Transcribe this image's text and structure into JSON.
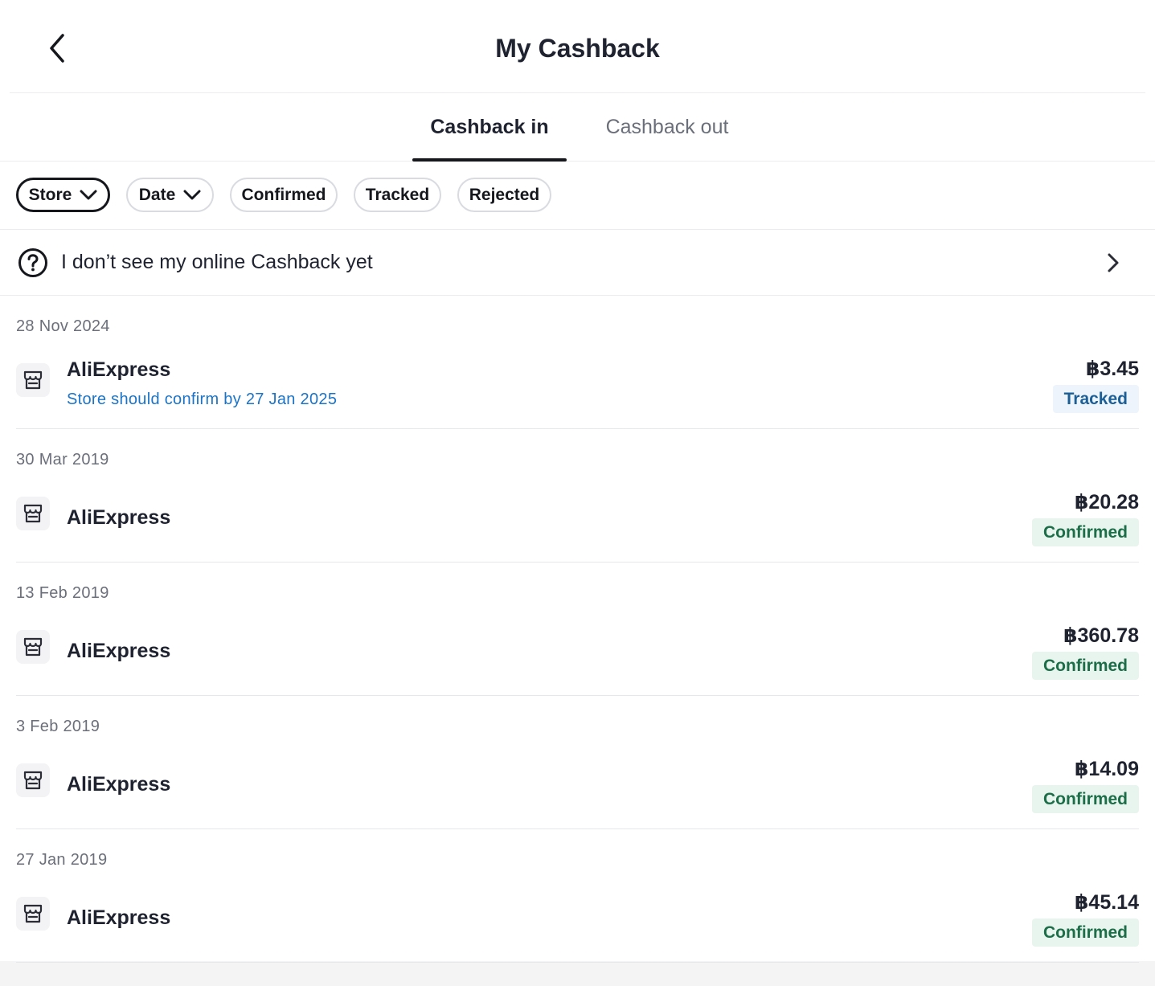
{
  "header": {
    "title": "My Cashback",
    "back_icon": "chevron-left-icon"
  },
  "tabs": [
    {
      "label": "Cashback in",
      "selected": true
    },
    {
      "label": "Cashback out",
      "selected": false
    }
  ],
  "filters": {
    "store": "Store",
    "date": "Date",
    "confirmed": "Confirmed",
    "tracked": "Tracked",
    "rejected": "Rejected"
  },
  "help": {
    "text": "I don’t see my online Cashback yet",
    "icon": "question-circle-icon"
  },
  "entries": [
    {
      "date": "28 Nov 2024",
      "store": "AliExpress",
      "note": "Store should confirm by 27 Jan 2025",
      "amount": "฿3.45",
      "status": "Tracked"
    },
    {
      "date": "30 Mar 2019",
      "store": "AliExpress",
      "amount": "฿20.28",
      "status": "Confirmed"
    },
    {
      "date": "13 Feb 2019",
      "store": "AliExpress",
      "amount": "฿360.78",
      "status": "Confirmed"
    },
    {
      "date": "3 Feb 2019",
      "store": "AliExpress",
      "amount": "฿14.09",
      "status": "Confirmed"
    },
    {
      "date": "27 Jan 2019",
      "store": "AliExpress",
      "amount": "฿45.14",
      "status": "Confirmed"
    }
  ],
  "colors": {
    "accent": "#4f5bff",
    "tracked_text": "#1b5f96",
    "confirmed_text": "#1b6e47",
    "note_text": "#1b74c7"
  }
}
